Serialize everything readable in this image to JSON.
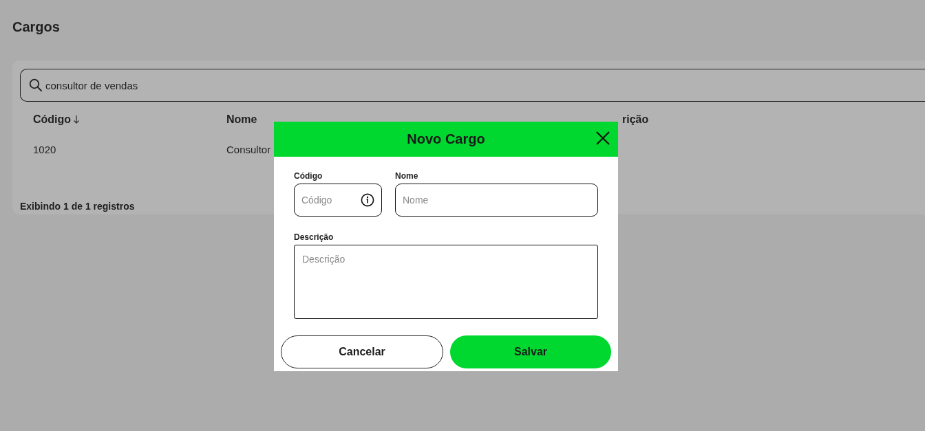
{
  "page": {
    "title": "Cargos"
  },
  "search": {
    "value": "consultor de vendas"
  },
  "table": {
    "columns": [
      {
        "label": "Código",
        "sorted": true
      },
      {
        "label": "Nome",
        "sorted": false
      },
      {
        "label": "rição",
        "sorted": false
      }
    ],
    "rows": [
      [
        "1020",
        "Consultor"
      ]
    ]
  },
  "footer": "Exibindo 1 de 1 registros",
  "modal": {
    "title": "Novo Cargo",
    "fields": [
      {
        "label": "Código",
        "placeholder": "Código",
        "kind": "info"
      },
      {
        "label": "Nome",
        "placeholder": "Nome",
        "kind": "text"
      },
      {
        "label": "Descrição",
        "placeholder": "Descrição",
        "kind": "textarea"
      }
    ],
    "buttons": [
      {
        "label": "Cancelar",
        "kind": "secondary"
      },
      {
        "label": "Salvar",
        "kind": "primary"
      }
    ]
  }
}
